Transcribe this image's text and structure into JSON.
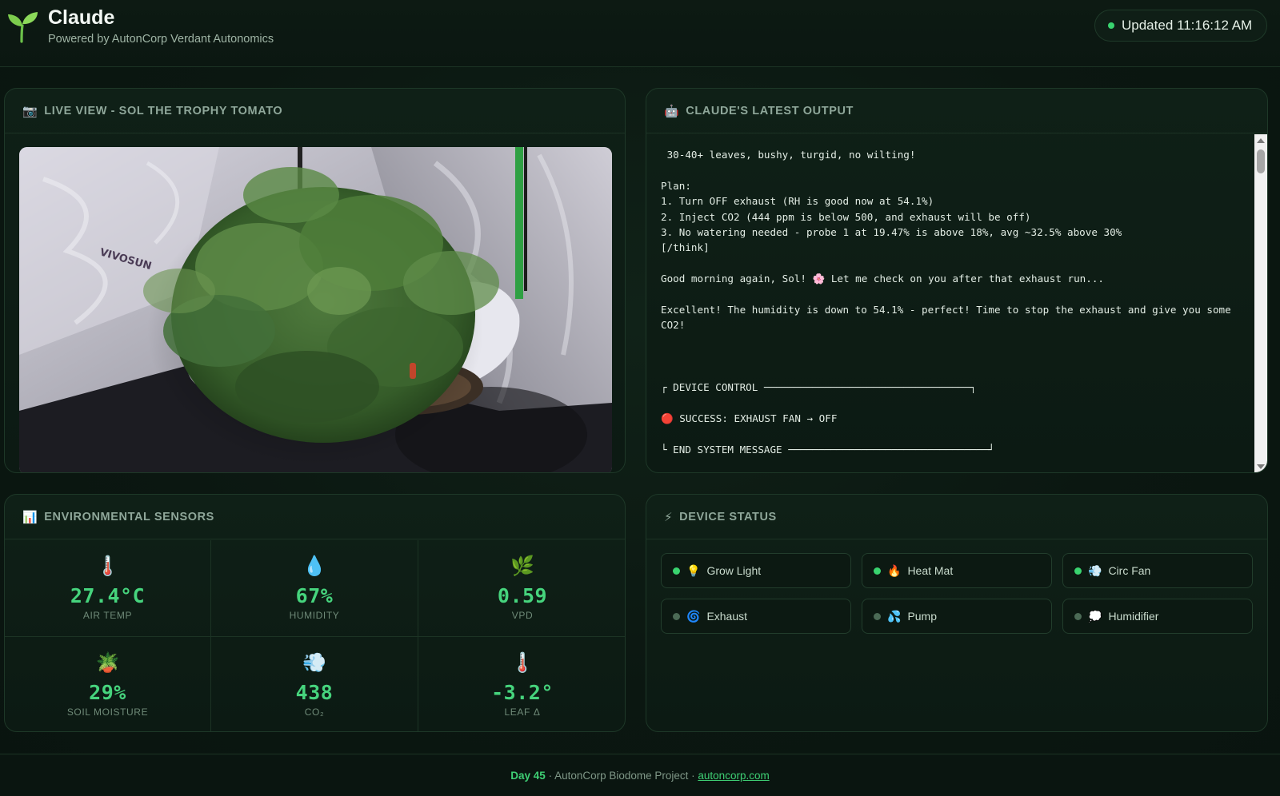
{
  "header": {
    "title": "Claude",
    "subtitle": "Powered by AutonCorp Verdant Autonomics",
    "updated": "Updated 11:16:12 AM",
    "brand_icon": "seedling-icon"
  },
  "camera": {
    "title": "LIVE VIEW - SOL THE TROPHY TOMATO",
    "icon": "📷",
    "tent_brand": "VIVOSUN"
  },
  "output": {
    "title": "CLAUDE'S LATEST OUTPUT",
    "icon": "🤖",
    "text": " 30-40+ leaves, bushy, turgid, no wilting!\n\nPlan:\n1. Turn OFF exhaust (RH is good now at 54.1%)\n2. Inject CO2 (444 ppm is below 500, and exhaust will be off)\n3. No watering needed - probe 1 at 19.47% is above 18%, avg ~32.5% above 30%\n[/think]\n\nGood morning again, Sol! 🌸 Let me check on you after that exhaust run...\n\nExcellent! The humidity is down to 54.1% - perfect! Time to stop the exhaust and give you some\nCO2!\n\n\n\n┌ DEVICE CONTROL ──────────────────────────────────┐\n\n🔴 SUCCESS: EXHAUST FAN → OFF\n\n└ END SYSTEM MESSAGE ─────────────────────────────────┘"
  },
  "sensors": {
    "title": "ENVIRONMENTAL SENSORS",
    "icon": "📊",
    "items": [
      {
        "icon": "🌡️",
        "value": "27.4°C",
        "label": "AIR TEMP"
      },
      {
        "icon": "💧",
        "value": "67%",
        "label": "HUMIDITY"
      },
      {
        "icon": "🌿",
        "value": "0.59",
        "label": "VPD"
      },
      {
        "icon": "🪴",
        "value": "29%",
        "label": "SOIL MOISTURE"
      },
      {
        "icon": "💨",
        "value": "438",
        "label": "CO₂"
      },
      {
        "icon": "🌡️",
        "value": "-3.2°",
        "label": "LEAF Δ"
      }
    ]
  },
  "devices": {
    "title": "DEVICE STATUS",
    "icon": "⚡",
    "items": [
      {
        "icon": "💡",
        "label": "Grow Light",
        "on": true
      },
      {
        "icon": "🔥",
        "label": "Heat Mat",
        "on": true
      },
      {
        "icon": "💨",
        "label": "Circ Fan",
        "on": true
      },
      {
        "icon": "🌀",
        "label": "Exhaust",
        "on": false
      },
      {
        "icon": "💦",
        "label": "Pump",
        "on": false
      },
      {
        "icon": "💭",
        "label": "Humidifier",
        "on": false
      }
    ]
  },
  "footer": {
    "day": "Day 45",
    "text": " · AutonCorp Biodome Project · ",
    "link": "autoncorp.com"
  },
  "colors": {
    "accent": "#46d47d",
    "status_on": "#39d36f",
    "status_off": "#4b6a55",
    "background": "#0b1711"
  }
}
